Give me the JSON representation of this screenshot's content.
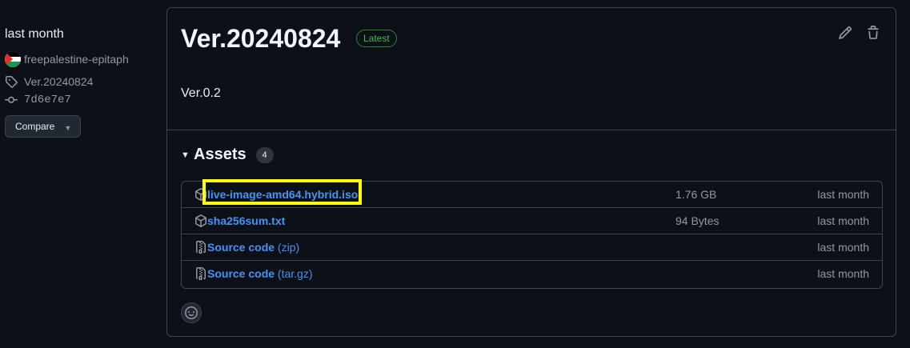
{
  "sidebar": {
    "date": "last month",
    "author": "freepalestine-epitaph",
    "tag": "Ver.20240824",
    "commit": "7d6e7e7",
    "compare_label": "Compare"
  },
  "release": {
    "title": "Ver.20240824",
    "badge": "Latest",
    "body": "Ver.0.2"
  },
  "assets": {
    "label": "Assets",
    "count": "4",
    "items": [
      {
        "name": "live-image-amd64.hybrid.iso",
        "ext": "",
        "size": "1.76 GB",
        "date": "last month",
        "icon": "package-icon"
      },
      {
        "name": "sha256sum.txt",
        "ext": "",
        "size": "94 Bytes",
        "date": "last month",
        "icon": "package-icon"
      },
      {
        "name": "Source code",
        "ext": "(zip)",
        "size": "",
        "date": "last month",
        "icon": "file-zip-icon"
      },
      {
        "name": "Source code",
        "ext": "(tar.gz)",
        "size": "",
        "date": "last month",
        "icon": "file-zip-icon"
      }
    ]
  },
  "colors": {
    "background": "#0d1117",
    "link": "#4493f8",
    "latest_badge": "#3fb950",
    "highlight": "#ffff00"
  }
}
